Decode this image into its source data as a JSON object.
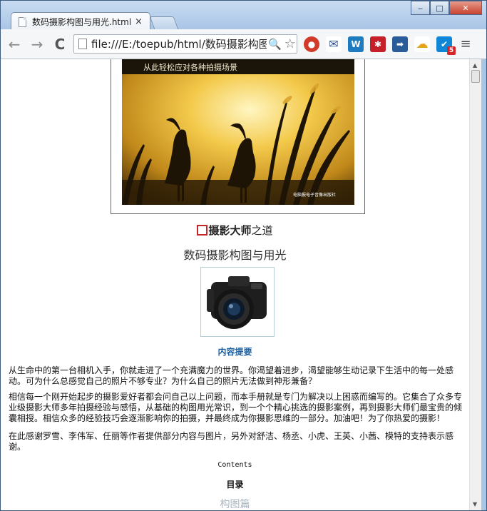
{
  "browser": {
    "tab_title": "数码摄影构图与用光.html",
    "tab_close": "×",
    "url": "file:///E:/toepub/html/数码摄影构图与用光.html",
    "window_buttons": {
      "minimize": "‒",
      "maximize": "□",
      "close": "✕"
    },
    "nav": {
      "back": "←",
      "forward": "→",
      "reload": "C"
    },
    "zoom_icon": "🔍",
    "bookmark_icon": "☆",
    "extensions": {
      "stop": "●",
      "mail": "✉",
      "word": "W",
      "star": "✱",
      "arrow": "➡",
      "cloud": "☁",
      "check": "✔",
      "check_badge": "5"
    },
    "menu": "≡"
  },
  "cover": {
    "tagline": "从此轻松应对各种拍摄场景",
    "publisher": "电脑报电子音像出版社"
  },
  "book": {
    "series_bold": "摄影大师",
    "series_light": "之道",
    "title": "数码摄影构图与用光"
  },
  "content": {
    "summary_heading": "内容提要",
    "paragraphs": [
      "从生命中的第一台相机入手，你就走进了一个充满魔力的世界。你渴望着进步，渴望能够生动记录下生活中的每一处感动。可为什么总感觉自己的照片不够专业？为什么自己的照片无法做到神形兼备？",
      "相信每一个刚开始起步的摄影爱好者都会问自己以上问题，而本手册就是专门为解决以上困惑而编写的。它集合了众多专业级摄影大师多年拍摄经验与感悟，从基础的构图用光常识，到一个个精心挑选的摄影案例，再到摄影大师们最宝贵的倾囊相授。相信众多的经验技巧会逐渐影响你的拍摄，并最终成为你摄影思维的一部分。加油吧！为了你热爱的摄影！",
      "在此感谢罗雪、李伟军、任丽等作者提供部分内容与图片，另外对舒洁、杨丞、小虎、王英、小茜、模特的支持表示感谢。"
    ],
    "contents_label": "Contents",
    "toc_heading": "目录",
    "next_heading": "构图篇"
  },
  "colors": {
    "accent_box": "#c4282a",
    "summary_heading": "#1a5fa0",
    "faded_heading": "#a9b5bf"
  }
}
